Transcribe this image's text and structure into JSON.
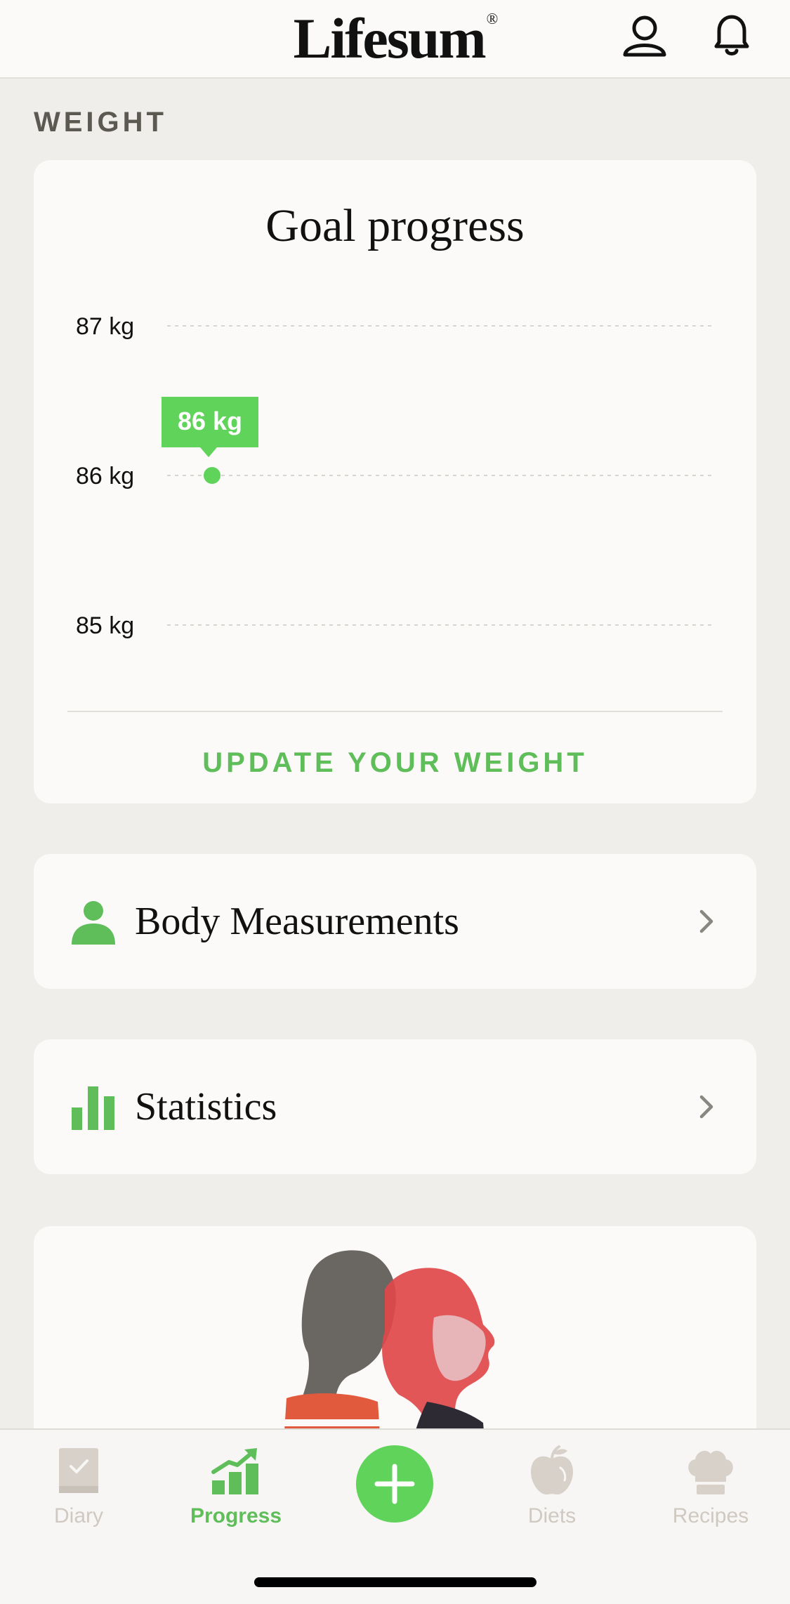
{
  "header": {
    "brand": "Lifesum",
    "brand_mark": "®",
    "profile_icon": "user-outline-icon",
    "notifications_icon": "bell-outline-icon"
  },
  "section_title": "WEIGHT",
  "goal_card": {
    "title": "Goal progress",
    "update_button": "UPDATE YOUR WEIGHT",
    "current_tooltip": "86 kg"
  },
  "chart_data": {
    "type": "scatter",
    "title": "Goal progress",
    "y_ticks": [
      "87 kg",
      "86 kg",
      "85 kg"
    ],
    "ylim": [
      85,
      87
    ],
    "unit": "kg",
    "points": [
      {
        "x": 0,
        "y": 86
      }
    ],
    "point_label": "86 kg",
    "grid": true,
    "accent": "#5fd35a"
  },
  "cards": {
    "body_measurements": {
      "label": "Body Measurements",
      "icon": "person-icon"
    },
    "statistics": {
      "label": "Statistics",
      "icon": "bar-chart-icon"
    }
  },
  "bottom_nav": {
    "items": [
      {
        "label": "Diary",
        "icon": "diary-book-icon",
        "active": false
      },
      {
        "label": "Progress",
        "icon": "progress-chart-icon",
        "active": true
      },
      {
        "label": "",
        "icon": "plus-icon",
        "active": false
      },
      {
        "label": "Diets",
        "icon": "apple-icon",
        "active": false
      },
      {
        "label": "Recipes",
        "icon": "chef-hat-icon",
        "active": false
      }
    ]
  },
  "colors": {
    "accent": "#5fbe5a",
    "background": "#f0eeea",
    "card": "#fbfaf8",
    "inactive": "#cfc9c1"
  }
}
